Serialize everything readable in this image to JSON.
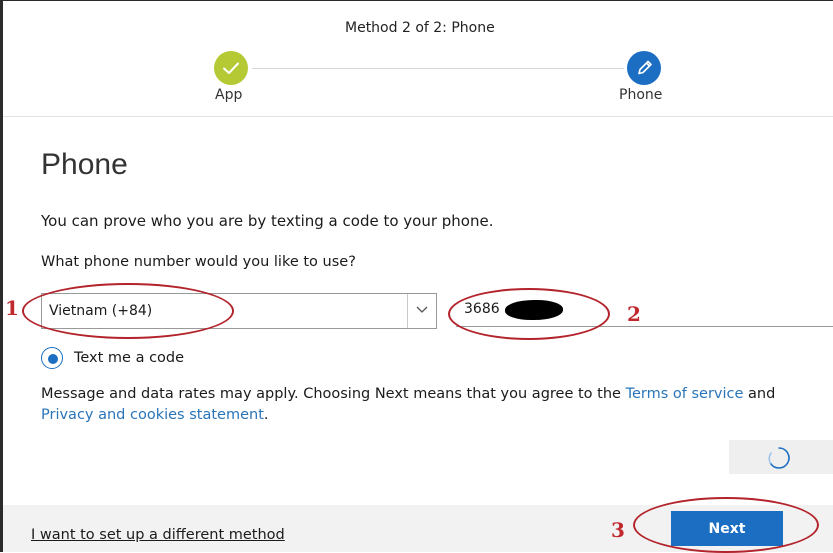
{
  "progress": {
    "title": "Method 2 of 2: Phone",
    "steps": [
      {
        "label": "App",
        "status": "completed",
        "icon": "check-icon",
        "color": "#b5c934"
      },
      {
        "label": "Phone",
        "status": "current",
        "icon": "pencil-icon",
        "color": "#1b6ec2"
      }
    ]
  },
  "main": {
    "heading": "Phone",
    "description": "You can prove who you are by texting a code to your phone.",
    "question": "What phone number would you like to use?",
    "country_select": {
      "value": "Vietnam (+84)"
    },
    "phone_field": {
      "value": "3686"
    },
    "radio": {
      "label": "Text me a code",
      "checked": true
    },
    "disclaimer": {
      "text_1": "Message and data rates may apply. Choosing Next means that you agree to the ",
      "terms_link": "Terms of service",
      "text_2": " and ",
      "privacy_link": "Privacy and cookies statement",
      "text_3": "."
    }
  },
  "footer": {
    "alt_method_link": "I want to set up a different method",
    "next_button": "Next"
  },
  "annotations": {
    "marker_1": "1",
    "marker_2": "2",
    "marker_3": "3",
    "color": "#b3232b"
  },
  "colors": {
    "accent": "#1b6ec2",
    "success": "#b5c934",
    "link": "#2a74b8"
  }
}
